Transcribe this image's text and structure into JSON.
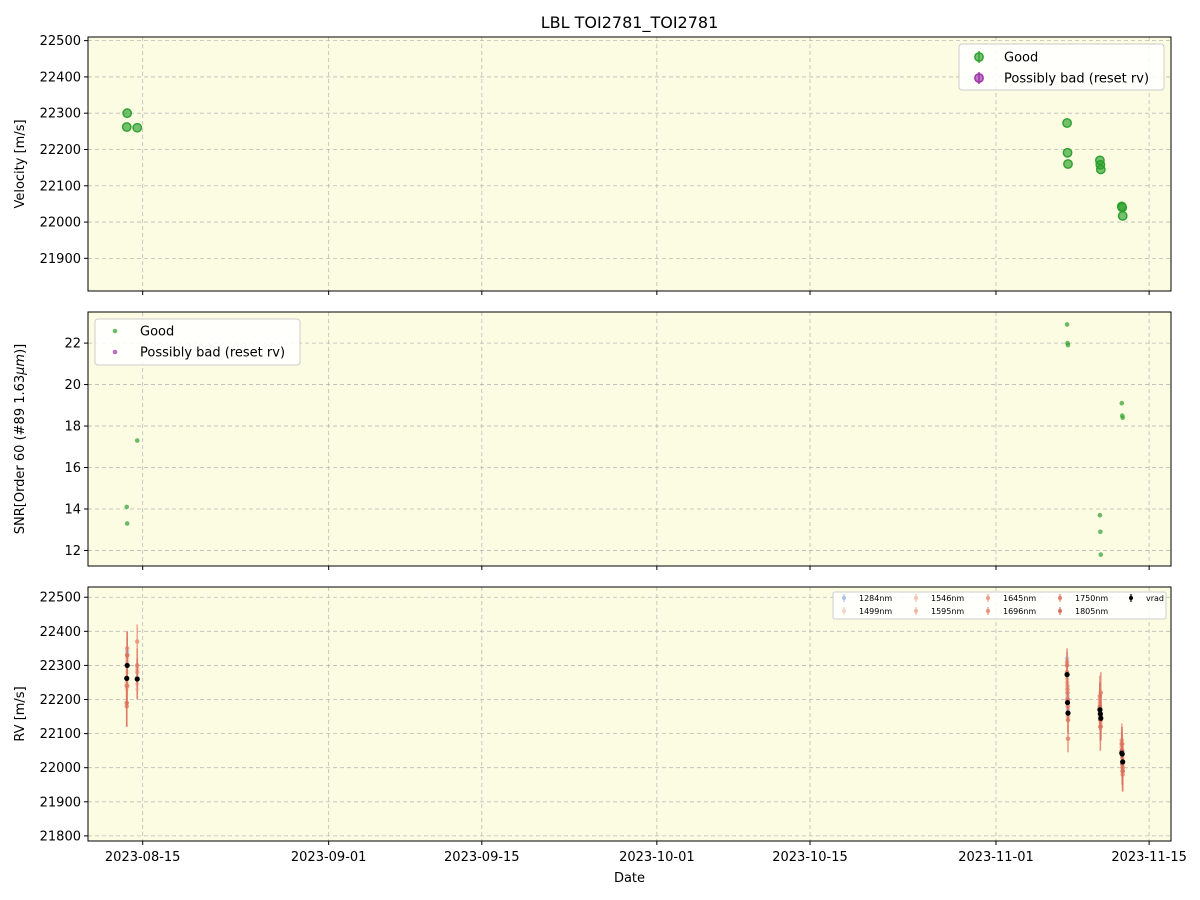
{
  "chart_data": [
    {
      "type": "scatter",
      "panel": "velocity",
      "title": "LBL TOI2781_TOI2781",
      "xlabel": "",
      "ylabel": "Velocity [m/s]",
      "xlim": [
        "2023-08-10T00:00",
        "2023-11-17T00:00"
      ],
      "ylim": [
        21810,
        22510
      ],
      "yticks": [
        21900,
        22000,
        22100,
        22200,
        22300,
        22400,
        22500
      ],
      "grid": true,
      "legend": "top-right",
      "series": [
        {
          "name": "Good",
          "color": "#2ca02c",
          "x": [
            "2023-08-13T13:00",
            "2023-08-13T14:00",
            "2023-08-14T12:00",
            "2023-11-07T12:00",
            "2023-11-07T13:00",
            "2023-11-07T14:00",
            "2023-11-10T12:00",
            "2023-11-10T13:00",
            "2023-11-10T14:00",
            "2023-11-12T12:00",
            "2023-11-12T13:00",
            "2023-11-12T14:00"
          ],
          "y": [
            22262,
            22300,
            22260,
            22273,
            22191,
            22160,
            22170,
            22158,
            22145,
            22043,
            22040,
            22017
          ]
        },
        {
          "name": "Possibly bad (reset rv)",
          "color": "#9b30a8",
          "x": [],
          "y": []
        }
      ]
    },
    {
      "type": "scatter",
      "panel": "snr",
      "xlabel": "",
      "ylabel": "SNR[Order 60 (#89 1.63μm)]",
      "xlim": [
        "2023-08-10T00:00",
        "2023-11-17T00:00"
      ],
      "ylim": [
        11.25,
        23.5
      ],
      "yticks": [
        12,
        14,
        16,
        18,
        20,
        22
      ],
      "grid": true,
      "legend": "top-left",
      "series": [
        {
          "name": "Good",
          "color": "#2ca02c",
          "x": [
            "2023-08-13T13:00",
            "2023-08-13T14:00",
            "2023-08-14T12:00",
            "2023-11-07T12:00",
            "2023-11-07T13:00",
            "2023-11-07T14:00",
            "2023-11-10T12:00",
            "2023-11-10T13:00",
            "2023-11-10T14:00",
            "2023-11-12T12:00",
            "2023-11-12T13:00",
            "2023-11-12T14:00"
          ],
          "y": [
            14.1,
            13.3,
            17.3,
            22.9,
            22.0,
            21.9,
            13.7,
            12.9,
            11.8,
            19.1,
            18.5,
            18.4
          ]
        },
        {
          "name": "Possibly bad (reset rv)",
          "color": "#9b30a8",
          "x": [],
          "y": []
        }
      ]
    },
    {
      "type": "scatter",
      "panel": "rv",
      "xlabel": "Date",
      "ylabel": "RV [m/s]",
      "xlim": [
        "2023-08-10T00:00",
        "2023-11-17T00:00"
      ],
      "ylim": [
        21785,
        22530
      ],
      "yticks": [
        21800,
        21900,
        22000,
        22100,
        22200,
        22300,
        22400,
        22500
      ],
      "xticks": [
        "2023-08-15",
        "2023-09-01",
        "2023-09-15",
        "2023-10-01",
        "2023-10-15",
        "2023-11-01",
        "2023-11-15"
      ],
      "grid": true,
      "legend": "top-right",
      "epochs": [
        "2023-08-13T13:00",
        "2023-08-13T14:00",
        "2023-08-14T12:00",
        "2023-11-07T12:00",
        "2023-11-07T13:00",
        "2023-11-07T14:00",
        "2023-11-10T12:00",
        "2023-11-10T13:00",
        "2023-11-10T14:00",
        "2023-11-12T12:00",
        "2023-11-12T13:00",
        "2023-11-12T14:00"
      ],
      "series": [
        {
          "name": "1284nm",
          "color": "#a8c4e0",
          "y": [
            22300,
            22340,
            22265,
            22320,
            22210,
            22170,
            22180,
            22170,
            22150,
            22050,
            22040,
            21990
          ],
          "err": [
            40,
            40,
            30,
            30,
            30,
            30,
            40,
            40,
            40,
            40,
            40,
            40
          ]
        },
        {
          "name": "1499nm",
          "color": "#f6d5c3",
          "y": [
            22230,
            22280,
            22230,
            22230,
            22180,
            22150,
            22150,
            22140,
            22120,
            22060,
            22030,
            22010
          ],
          "err": [
            40,
            40,
            30,
            30,
            30,
            30,
            40,
            40,
            40,
            40,
            40,
            40
          ]
        },
        {
          "name": "1546nm",
          "color": "#f4c4b0",
          "y": [
            22250,
            22320,
            22245,
            22260,
            22200,
            22160,
            22160,
            22150,
            22130,
            22050,
            22040,
            22000
          ],
          "err": [
            40,
            40,
            30,
            30,
            30,
            30,
            40,
            40,
            40,
            40,
            40,
            40
          ]
        },
        {
          "name": "1595nm",
          "color": "#f2b4a0",
          "y": [
            22240,
            22310,
            22290,
            22250,
            22190,
            22150,
            22170,
            22140,
            22120,
            22070,
            22050,
            22020
          ],
          "err": [
            40,
            40,
            30,
            30,
            30,
            30,
            40,
            40,
            40,
            40,
            40,
            40
          ]
        },
        {
          "name": "1645nm",
          "color": "#ee9e88",
          "y": [
            22260,
            22330,
            22280,
            22300,
            22240,
            22200,
            22190,
            22160,
            22140,
            22060,
            22030,
            21990
          ],
          "err": [
            50,
            50,
            40,
            40,
            40,
            40,
            50,
            50,
            50,
            50,
            50,
            50
          ]
        },
        {
          "name": "1696nm",
          "color": "#ea8f7a",
          "y": [
            22240,
            22350,
            22370,
            22310,
            22230,
            22180,
            22200,
            22170,
            22150,
            22080,
            22070,
            21980
          ],
          "err": [
            50,
            50,
            50,
            40,
            40,
            40,
            50,
            50,
            50,
            50,
            50,
            50
          ]
        },
        {
          "name": "1750nm",
          "color": "#e47f6a",
          "y": [
            22180,
            22240,
            22300,
            22300,
            22220,
            22085,
            22210,
            22140,
            22220,
            22070,
            22050,
            22000
          ],
          "err": [
            60,
            60,
            50,
            40,
            40,
            40,
            60,
            60,
            60,
            50,
            50,
            50
          ]
        },
        {
          "name": "1805nm",
          "color": "#d9705c",
          "y": [
            22190,
            22330,
            22260,
            22280,
            22200,
            22140,
            22180,
            22120,
            22150,
            22050,
            22010,
            21990
          ],
          "err": [
            70,
            70,
            60,
            40,
            40,
            40,
            70,
            70,
            70,
            60,
            60,
            60
          ]
        },
        {
          "name": "vrad",
          "color": "#000000",
          "y": [
            22262,
            22300,
            22260,
            22273,
            22191,
            22160,
            22170,
            22158,
            22145,
            22043,
            22040,
            22017
          ],
          "err": [
            5,
            5,
            5,
            5,
            5,
            5,
            5,
            5,
            5,
            5,
            5,
            5
          ]
        }
      ]
    }
  ]
}
